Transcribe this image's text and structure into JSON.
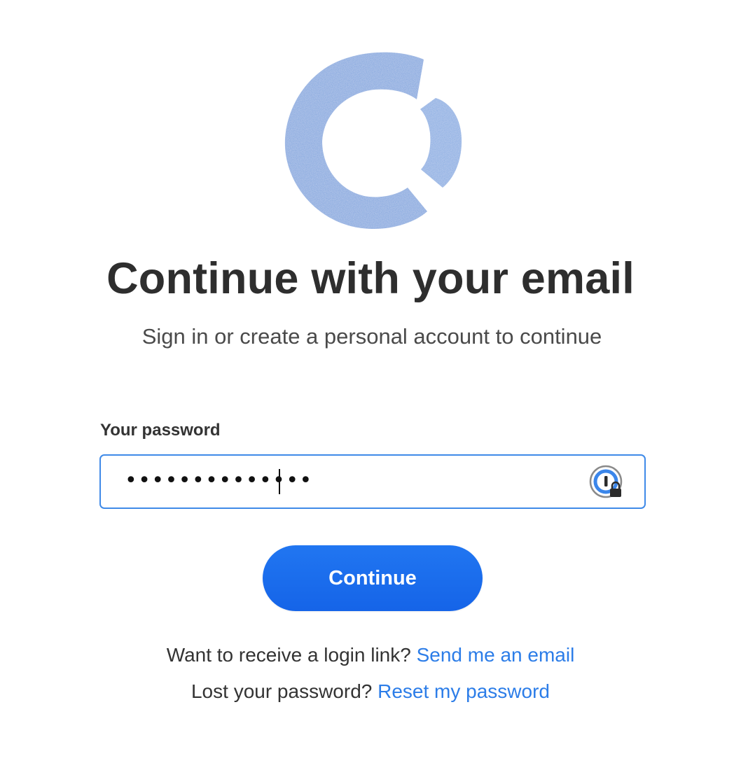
{
  "header": {
    "title": "Continue with your email",
    "subtitle": "Sign in or create a personal account to continue"
  },
  "form": {
    "password_label": "Your password",
    "password_masked": "••••••••••••••",
    "continue_label": "Continue"
  },
  "links": {
    "login_link_prompt": "Want to receive a login link?",
    "login_link_action": "Send me an email",
    "lost_password_prompt": "Lost your password?",
    "lost_password_action": "Reset my password"
  },
  "icons": {
    "logo": "brand-logo-icon",
    "password_manager": "password-manager-lock-icon"
  },
  "colors": {
    "accent": "#1a6cf0",
    "link": "#2c7de8",
    "logo_blue": "#7ea3dc",
    "input_border": "#3f8ae8"
  }
}
